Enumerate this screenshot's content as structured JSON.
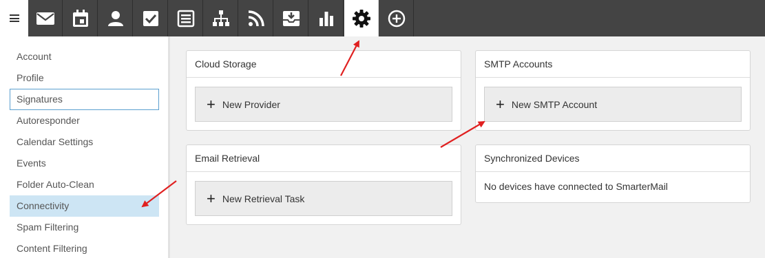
{
  "topnav": {
    "items": [
      {
        "icon": "mail-icon"
      },
      {
        "icon": "calendar-icon"
      },
      {
        "icon": "contacts-icon"
      },
      {
        "icon": "tasks-icon"
      },
      {
        "icon": "notes-icon"
      },
      {
        "icon": "org-chart-icon"
      },
      {
        "icon": "rss-icon"
      },
      {
        "icon": "file-storage-icon"
      },
      {
        "icon": "reports-icon"
      },
      {
        "icon": "settings-icon",
        "active": true
      },
      {
        "icon": "add-circle-icon"
      }
    ]
  },
  "sidebar": {
    "items": [
      {
        "label": "Account"
      },
      {
        "label": "Profile"
      },
      {
        "label": "Signatures",
        "focused": true
      },
      {
        "label": "Autoresponder"
      },
      {
        "label": "Calendar Settings"
      },
      {
        "label": "Events"
      },
      {
        "label": "Folder Auto-Clean"
      },
      {
        "label": "Connectivity",
        "selected": true
      },
      {
        "label": "Spam Filtering"
      },
      {
        "label": "Content Filtering"
      }
    ]
  },
  "cards": {
    "cloud_storage": {
      "title": "Cloud Storage",
      "button": "New Provider"
    },
    "smtp_accounts": {
      "title": "SMTP Accounts",
      "button": "New SMTP Account"
    },
    "email_retrieval": {
      "title": "Email Retrieval",
      "button": "New Retrieval Task"
    },
    "sync_devices": {
      "title": "Synchronized Devices",
      "message": "No devices have connected to SmarterMail"
    }
  },
  "colors": {
    "topbar": "#444444",
    "selected_item": "#cde5f4",
    "focus_border": "#5a9fcf",
    "annotation_arrow": "#e02020"
  }
}
